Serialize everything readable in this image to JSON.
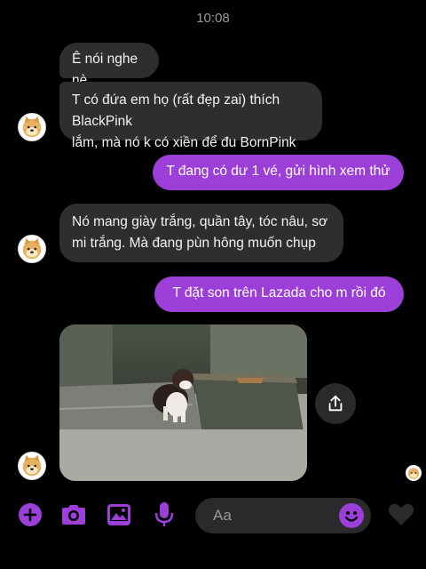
{
  "status": {
    "time": "10:08"
  },
  "messages": [
    {
      "side": "in",
      "text": "Ê nói nghe nè"
    },
    {
      "side": "in",
      "lines": [
        "T có đứa em họ (rất đẹp zai) thích BlackPink",
        "lắm, mà nó k có xiền để đu BornPink"
      ]
    },
    {
      "side": "out",
      "text": "T đang có dư 1 vé, gửi hình xem thử"
    },
    {
      "side": "in",
      "lines": [
        "Nó mang giày trắng, quần tây, tóc nâu, sơ",
        "mi trắng. Mà đang pùn hông muốn chụp"
      ]
    },
    {
      "side": "out",
      "text": "T đặt son trên Lazada cho m rồi đó"
    }
  ],
  "photo": {
    "icon": "puppy-photo"
  },
  "composer": {
    "placeholder": "Aa",
    "icons": [
      "plus-icon",
      "camera-icon",
      "gallery-icon",
      "microphone-icon",
      "emoji-icon",
      "heart-icon",
      "share-icon"
    ]
  },
  "colors": {
    "accent": "#9b3fd8",
    "incoming_bubble": "#2e2e2e",
    "background": "#000000"
  }
}
